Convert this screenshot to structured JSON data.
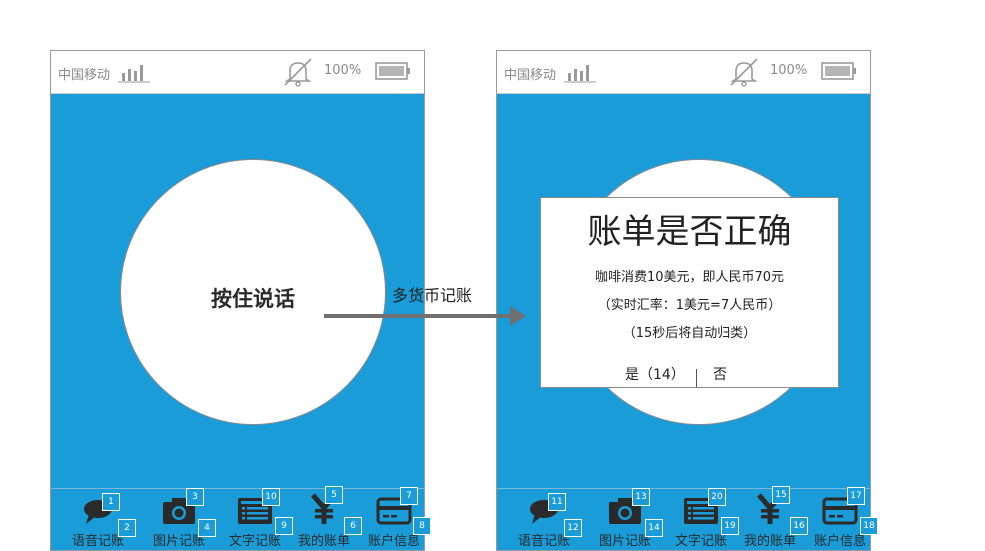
{
  "status_bar": {
    "carrier": "中国移动",
    "battery": "100%"
  },
  "record_screen": {
    "press_label": "按住说话"
  },
  "transition": {
    "label": "多货币记账"
  },
  "dialog": {
    "title": "账单是否正确",
    "line1": "咖啡消费10美元，即人民币70元",
    "line2": "（实时汇率：1美元=7人民币）",
    "line3": "（15秒后将自动归类）",
    "yes_label": "是（14）",
    "no_label": "否"
  },
  "tabs": [
    {
      "label": "语音记账",
      "icon": "speech-bubble-icon"
    },
    {
      "label": "图片记账",
      "icon": "camera-icon"
    },
    {
      "label": "文字记账",
      "icon": "text-list-icon"
    },
    {
      "label": "我的账单",
      "icon": "yen-icon"
    },
    {
      "label": "账户信息",
      "icon": "card-icon"
    }
  ],
  "markers_left": [
    "1",
    "2",
    "3",
    "4",
    "10",
    "9",
    "5",
    "6",
    "7",
    "8"
  ],
  "markers_right": [
    "11",
    "12",
    "13",
    "14",
    "20",
    "19",
    "15",
    "16",
    "17",
    "18"
  ],
  "colors": {
    "screen_bg": "#1a9cd8",
    "icon": "#2a2a2a",
    "arrow": "#707070"
  }
}
